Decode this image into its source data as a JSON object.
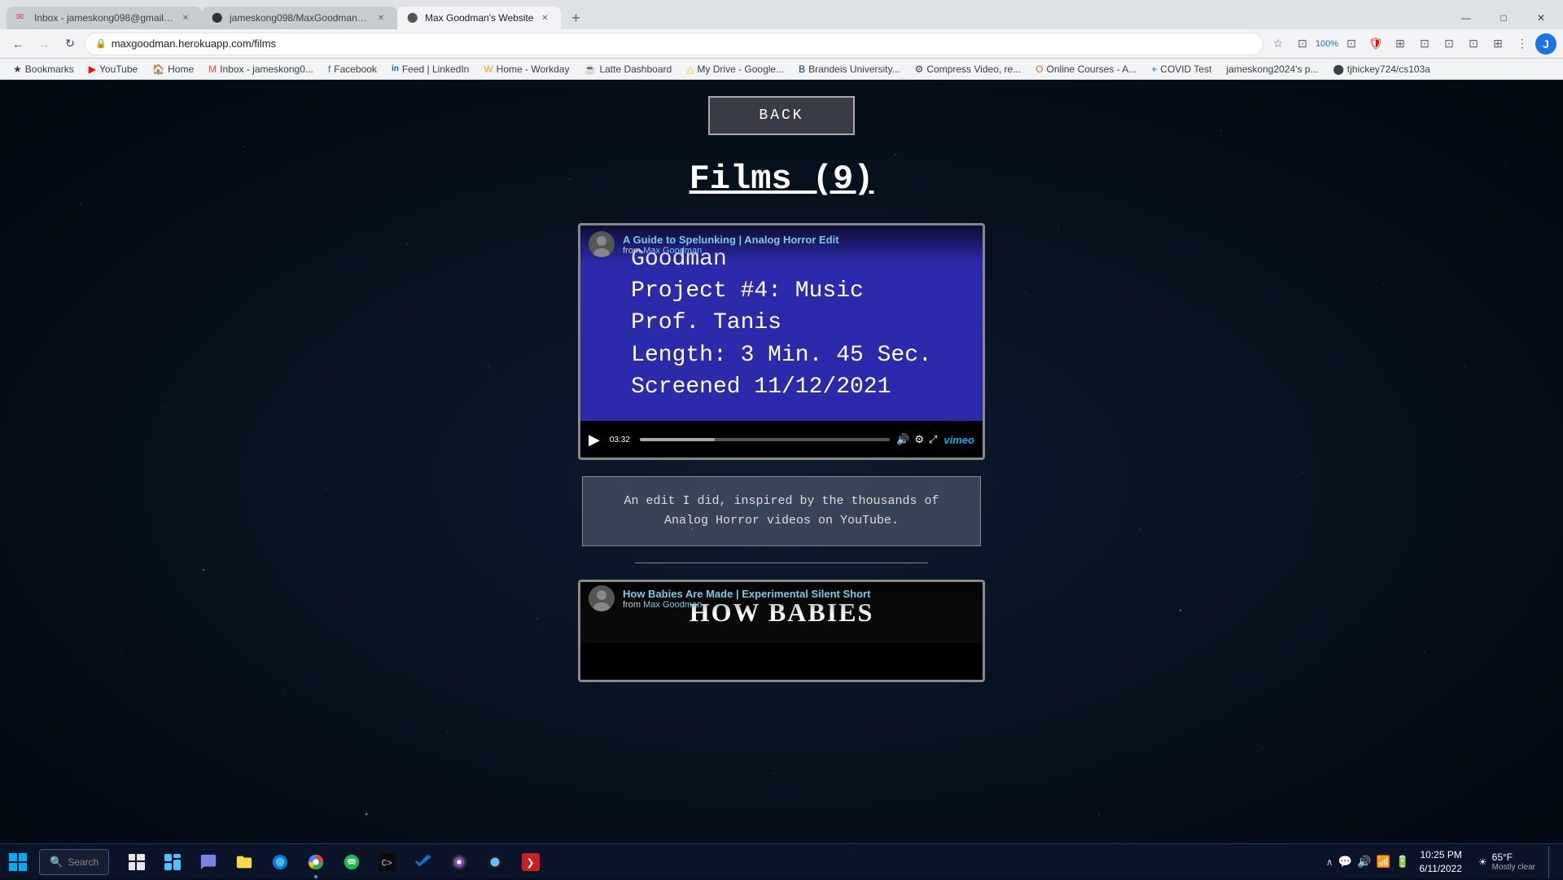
{
  "browser": {
    "tabs": [
      {
        "id": "tab-gmail",
        "title": "Inbox - jameskong098@gmail.c...",
        "favicon": "✉",
        "active": false,
        "favicon_color": "#ea4335"
      },
      {
        "id": "tab-github",
        "title": "jameskong098/MaxGoodmanW...",
        "favicon": "⬤",
        "active": false,
        "favicon_color": "#333"
      },
      {
        "id": "tab-maxgoodman",
        "title": "Max Goodman's Website",
        "favicon": "⬤",
        "active": true,
        "favicon_color": "#555"
      }
    ],
    "address": "maxgoodman.herokuapp.com/films",
    "window_controls": [
      "—",
      "□",
      "✕"
    ]
  },
  "bookmarks": [
    {
      "label": "Bookmarks",
      "icon": "★"
    },
    {
      "label": "YouTube",
      "icon": "▶",
      "color": "red"
    },
    {
      "label": "Home",
      "icon": "🏠"
    },
    {
      "label": "Inbox - jameskong0...",
      "icon": "✉"
    },
    {
      "label": "Facebook",
      "icon": "f"
    },
    {
      "label": "Feed | LinkedIn",
      "icon": "in"
    },
    {
      "label": "Home - Workday",
      "icon": "W"
    },
    {
      "label": "Latte Dashboard",
      "icon": "☕"
    },
    {
      "label": "My Drive - Google...",
      "icon": "△"
    },
    {
      "label": "Brandeis University...",
      "icon": "B"
    },
    {
      "label": "Compress Video, re...",
      "icon": "⚙"
    },
    {
      "label": "Online Courses - A...",
      "icon": "O"
    },
    {
      "label": "COVID Test",
      "icon": "+"
    },
    {
      "label": "jameskong2024's p...",
      "icon": "J"
    },
    {
      "label": "tjhickey724/cs103a",
      "icon": "⬤"
    }
  ],
  "page": {
    "back_button": "BACK",
    "title": "Films (9)",
    "films": [
      {
        "id": "film-1",
        "vimeo_title": "A Guide to Spelunking | Analog Horror Edit",
        "vimeo_from": "from",
        "vimeo_author": "Max Goodman",
        "time": "03:32",
        "content_lines": [
          "Goodman",
          "Project #4: Music",
          "Prof. Tanis",
          "Length: 3 Min. 45 Sec.",
          "Screened 11/12/2021"
        ],
        "description": "An edit I did, inspired by the thousands of\nAnalog Horror videos on YouTube."
      },
      {
        "id": "film-2",
        "vimeo_title": "How Babies Are Made | Experimental Silent Short",
        "vimeo_from": "from",
        "vimeo_author": "Max Goodman",
        "content_text": "HOW BABIES"
      }
    ]
  },
  "taskbar": {
    "weather_temp": "65°F",
    "weather_desc": "Mostly clear",
    "time": "10:25 PM",
    "date": "6/11/2022",
    "apps": [
      {
        "name": "windows-start",
        "icon": "⊞"
      },
      {
        "name": "search",
        "icon": "🔍",
        "label": ""
      },
      {
        "name": "task-view",
        "icon": "⧉"
      },
      {
        "name": "file-explorer",
        "icon": "📁"
      },
      {
        "name": "edge",
        "icon": "○"
      },
      {
        "name": "chrome",
        "icon": "◉",
        "active": true
      },
      {
        "name": "spotify",
        "icon": "◎"
      },
      {
        "name": "terminal",
        "icon": "⬛"
      },
      {
        "name": "vscode",
        "icon": "◈"
      },
      {
        "name": "obs",
        "icon": "⬤"
      },
      {
        "name": "steam",
        "icon": "◑"
      },
      {
        "name": "arrow",
        "icon": "❯"
      }
    ],
    "system_icons": [
      "∧",
      "💬",
      "🔊",
      "📶",
      "🔋"
    ]
  }
}
